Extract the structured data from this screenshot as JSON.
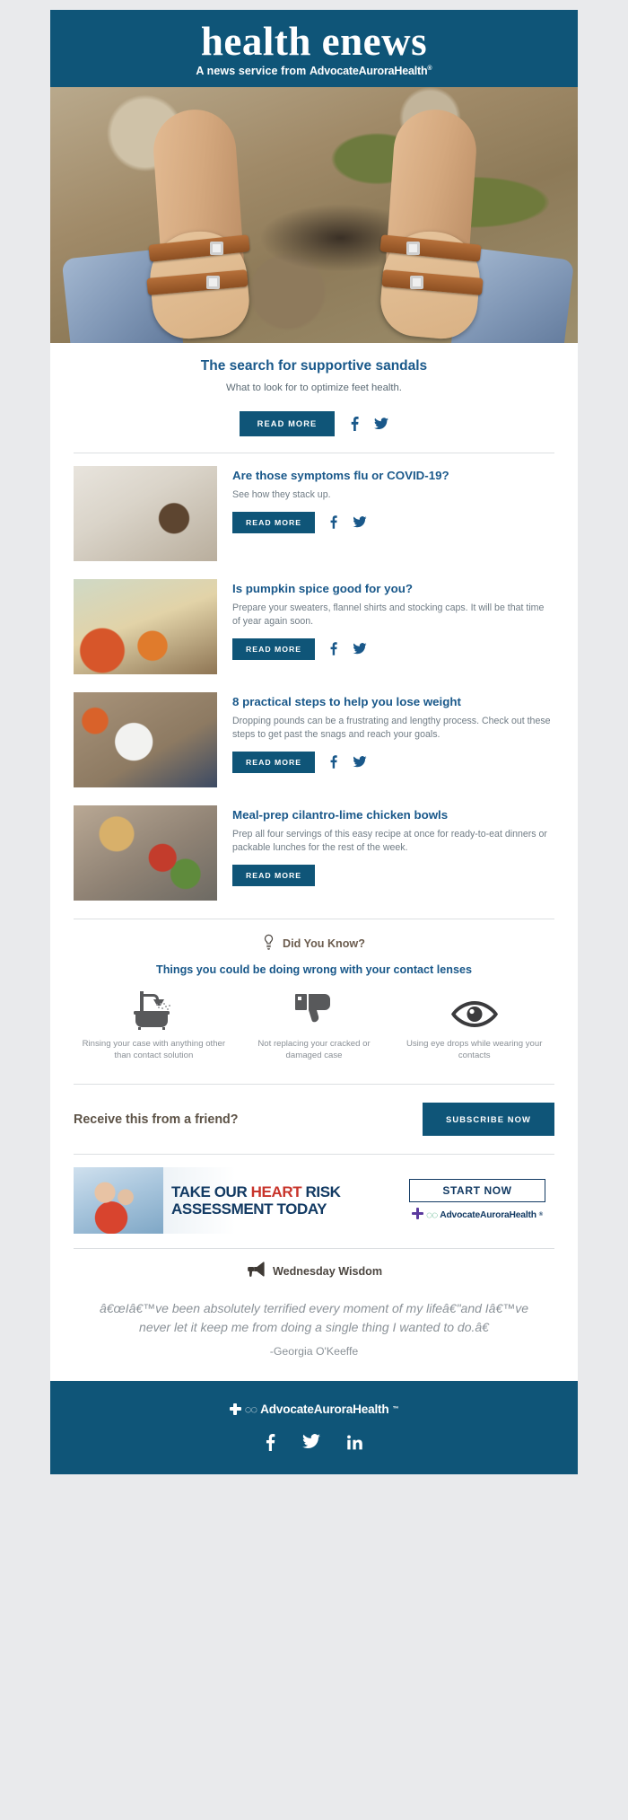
{
  "masthead": {
    "title": "health enews",
    "tagline_prefix": "A news service from ",
    "brand": "AdvocateAuroraHealth",
    "tm": "®"
  },
  "feature": {
    "image_alt": "feet-in-sandals-photo",
    "title": "The search for supportive sandals",
    "summary": "What to look for to optimize feet health.",
    "read_more": "READ MORE"
  },
  "articles": [
    {
      "thumb": "woman-on-phone-photo",
      "title": "Are those symptoms flu or COVID-19?",
      "summary": "See how they stack up.",
      "read_more": "READ MORE",
      "has_social": true
    },
    {
      "thumb": "pumpkin-spice-autumn-photo",
      "title": "Is pumpkin spice good for you?",
      "summary": "Prepare your sweaters, flannel shirts and stocking caps. It will be that time of year again soon.",
      "read_more": "READ MORE",
      "has_social": true
    },
    {
      "thumb": "healthy-salad-meal-photo",
      "title": "8 practical steps to help you lose weight",
      "summary": "Dropping pounds can be a frustrating and lengthy process. Check out these steps to get past the snags and reach your goals.",
      "read_more": "READ MORE",
      "has_social": true
    },
    {
      "thumb": "cilantro-lime-chicken-bowl-photo",
      "title": "Meal-prep cilantro-lime chicken bowls",
      "summary": "Prep all four servings of this easy recipe at once for ready-to-eat dinners or packable lunches for the rest of the week.",
      "read_more": "READ MORE",
      "has_social": false
    }
  ],
  "did_you_know": {
    "label": "Did You Know?",
    "heading": "Things you could be doing wrong with your contact lenses",
    "items": [
      {
        "icon": "shower-icon",
        "caption": "Rinsing your case with anything other than contact solution"
      },
      {
        "icon": "thumbs-down-icon",
        "caption": "Not replacing your cracked or damaged case"
      },
      {
        "icon": "eye-icon",
        "caption": "Using eye drops while wearing your contacts"
      }
    ]
  },
  "subscribe": {
    "prompt": "Receive this from a friend?",
    "button": "SUBSCRIBE NOW"
  },
  "ad": {
    "line1_a": "TAKE OUR ",
    "line1_b": "HEART",
    "line1_c": " RISK",
    "line2": "ASSESSMENT TODAY",
    "button": "START NOW",
    "brand": "AdvocateAuroraHealth",
    "tm": "®",
    "image_alt": "senior-couple-on-boat-photo"
  },
  "wisdom": {
    "label": "Wednesday Wisdom",
    "quote": "â€œIâ€™ve been absolutely terrified every moment of my lifeâ€\"and Iâ€™ve never let it keep me from doing a single thing I wanted to do.â€",
    "attribution": "-Georgia O'Keeffe"
  },
  "footer": {
    "brand": "AdvocateAuroraHealth",
    "tm": "™",
    "social": [
      "facebook-icon",
      "twitter-icon",
      "linkedin-icon"
    ]
  },
  "colors": {
    "brand_blue": "#0f5578",
    "link_blue": "#19588a",
    "body_gray": "#707c85",
    "ad_red": "#c8342b"
  }
}
